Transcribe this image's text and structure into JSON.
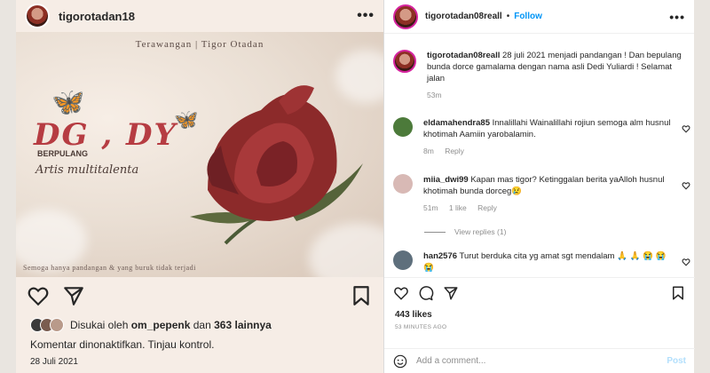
{
  "left": {
    "username": "tigorotadan18",
    "image": {
      "top_text": "Terawangan | Tigor Otadan",
      "title": "DG , DY",
      "subtitle": "BERPULANG",
      "script_text": "Artis multitalenta",
      "bottom_text": "Semoga hanya pandangan & yang buruk tidak terjadi"
    },
    "liked_by_prefix": "Disukai oleh",
    "liked_by_user": "om_pepenk",
    "liked_by_mid": "dan",
    "liked_by_count": "363 lainnya",
    "comments_off": "Komentar dinonaktifkan. Tinjau kontrol.",
    "date": "28 Juli 2021"
  },
  "right": {
    "header": {
      "username": "tigorotadan08reall",
      "separator": "•",
      "follow": "Follow"
    },
    "caption": {
      "username": "tigorotadan08reall",
      "text": "28 juli 2021 menjadi pandangan ! Dan bepulang bunda dorce gamalama dengan nama asli Dedi Yuliardi ! Selamat jalan",
      "time": "53m"
    },
    "comments": [
      {
        "username": "eldamahendra85",
        "text": "Innalillahi Wainalillahi rojiun semoga alm husnul khotimah Aamiin yarobalamin.",
        "time": "8m",
        "likes": "",
        "reply": "Reply",
        "avatar_color": "#4c7a3a"
      },
      {
        "username": "miia_dwi99",
        "text": "Kapan mas tigor? Ketinggalan berita yaAlloh husnul khotimah bunda dorceg😢",
        "time": "51m",
        "likes": "1 like",
        "reply": "Reply",
        "avatar_color": "#d8b9b5"
      },
      {
        "username": "han2576",
        "text": "Turut berduka cita yg amat sgt mendalam 🙏 🙏 😭 😭 😭",
        "time": "",
        "likes": "",
        "reply": "",
        "avatar_color": "#5e6f7c"
      }
    ],
    "view_replies": "View replies (1)",
    "likes": "443 likes",
    "time_ago": "53 MINUTES AGO",
    "add_comment_placeholder": "Add a comment...",
    "post_button": "Post"
  },
  "colors": {
    "follow": "#0095f6",
    "meta": "#8e8e8e",
    "rose": "#8c2a2a",
    "accent_title": "#b63c42"
  }
}
